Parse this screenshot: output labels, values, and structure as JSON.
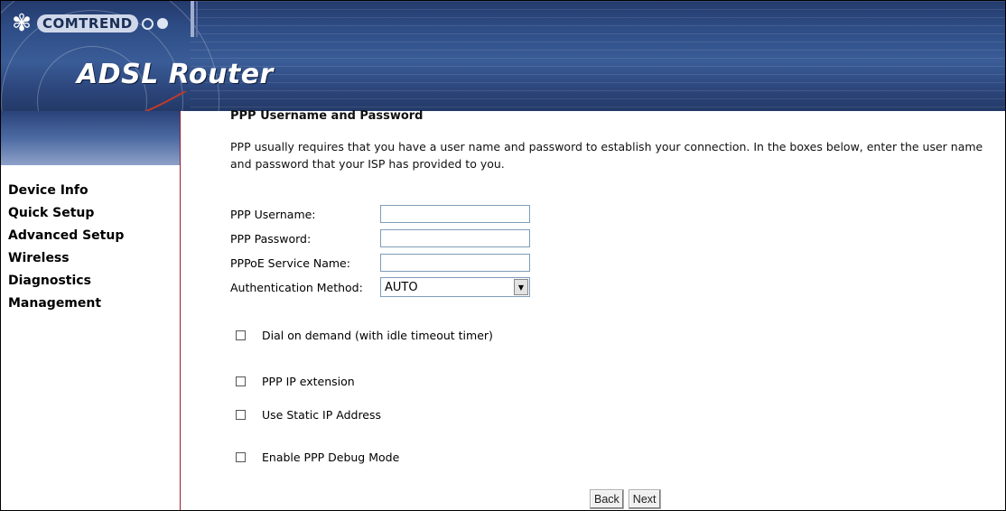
{
  "header": {
    "brand": "COMTREND",
    "product": "ADSL Router"
  },
  "sidebar": {
    "items": [
      {
        "label": "Device Info"
      },
      {
        "label": "Quick Setup"
      },
      {
        "label": "Advanced Setup"
      },
      {
        "label": "Wireless"
      },
      {
        "label": "Diagnostics"
      },
      {
        "label": "Management"
      }
    ]
  },
  "main": {
    "title": "PPP Username and Password",
    "description": "PPP usually requires that you have a user name and password to establish your connection. In the boxes below, enter the user name and password that your ISP has provided to you.",
    "fields": {
      "username_label": "PPP Username:",
      "username_value": "",
      "password_label": "PPP Password:",
      "password_value": "",
      "service_label": "PPPoE Service Name:",
      "service_value": "",
      "auth_label": "Authentication Method:",
      "auth_value": "AUTO"
    },
    "checkboxes": {
      "dial_on_demand": "Dial on demand (with idle timeout timer)",
      "ip_extension": "PPP IP extension",
      "static_ip": "Use Static IP Address",
      "debug_mode": "Enable PPP Debug Mode"
    },
    "buttons": {
      "back": "Back",
      "next": "Next"
    }
  },
  "colors": {
    "banner": "#2e4d86",
    "sidebar_border": "#9a1b2b"
  }
}
